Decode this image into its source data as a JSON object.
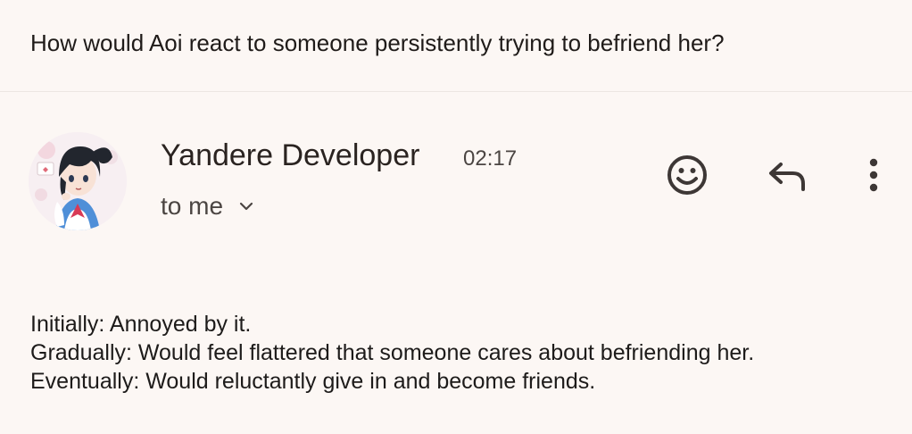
{
  "email": {
    "subject": "How would Aoi react to someone persistently trying to befriend her?",
    "sender": {
      "name": "Yandere Developer",
      "time": "02:17",
      "recipient": "to me",
      "avatar": "avatar-illustration"
    },
    "actions": {
      "emoji_icon": "smiley-face-icon",
      "reply_icon": "reply-arrow-icon",
      "more_icon": "more-vert-icon"
    },
    "body": {
      "lines": [
        "Initially: Annoyed by it.",
        "Gradually: Would feel flattered that someone cares about befriending her.",
        "Eventually: Would reluctantly give in and become friends."
      ]
    }
  },
  "colors": {
    "background": "#fcf7f4",
    "text_primary": "#1d1b1a",
    "text_secondary": "#4b4542",
    "divider": "#ece6e2"
  }
}
